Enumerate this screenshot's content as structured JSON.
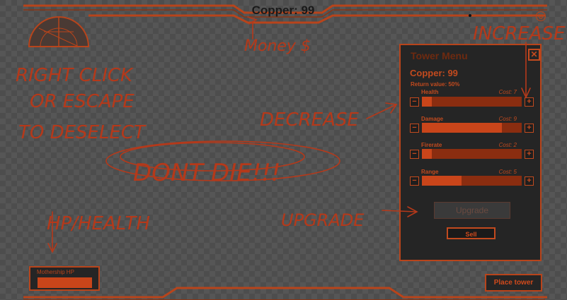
{
  "hud": {
    "copper_display": "Copper: 99"
  },
  "tower_menu": {
    "title": "Tower Menu",
    "close_icon": "close-icon",
    "copper": "Copper: 99",
    "return_value": "Return value: 50%",
    "stats": [
      {
        "name": "Health",
        "cost": "Cost: 7",
        "fill": 0.1
      },
      {
        "name": "Damage",
        "cost": "Cost: 9",
        "fill": 0.8
      },
      {
        "name": "Firerate",
        "cost": "Cost: 2",
        "fill": 0.1
      },
      {
        "name": "Range",
        "cost": "Cost: 5",
        "fill": 0.4
      }
    ],
    "decrease_symbol": "−",
    "increase_symbol": "+",
    "upgrade_label": "Upgrade",
    "sell_label": "Sell"
  },
  "mothership": {
    "label": "Mothership HP",
    "hp_fill": 1.0
  },
  "place_tower_label": "Place tower",
  "annotations": {
    "money": "Money $",
    "increase": "INCREASE",
    "deselect_line1": "RIGHT CLICK",
    "deselect_line2": "OR ESCAPE",
    "deselect_line3": "TO DESELECT",
    "decrease": "DECREASE",
    "dont_die": "DONT DIE!!!",
    "hp_health": "HP/HEALTH",
    "upgrade": "UPGRADE"
  },
  "colors": {
    "accent": "#c24a1e",
    "panel": "#252525",
    "annotation_ink": "#b5391a"
  }
}
